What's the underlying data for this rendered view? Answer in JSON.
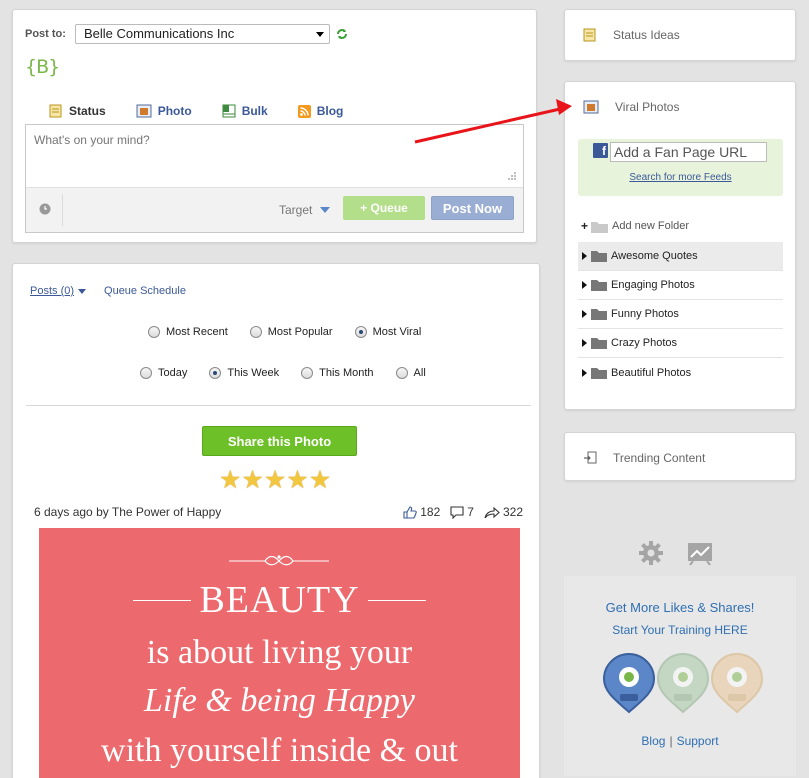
{
  "compose": {
    "post_to_label": "Post to:",
    "page_selected": "Belle Communications Inc",
    "brand_logo": "{B}",
    "tabs": [
      {
        "label": "Status",
        "icon": "note-icon",
        "active": true
      },
      {
        "label": "Photo",
        "icon": "photo-icon",
        "active": false
      },
      {
        "label": "Bulk",
        "icon": "spreadsheet-icon",
        "active": false
      },
      {
        "label": "Blog",
        "icon": "rss-icon",
        "active": false
      }
    ],
    "placeholder": "What's on your mind?",
    "target_label": "Target",
    "queue_label": "+ Queue",
    "post_now_label": "Post Now"
  },
  "feed": {
    "posts_label": "Posts (0)",
    "schedule_label": "Queue Schedule",
    "sort_options": [
      {
        "label": "Most Recent",
        "checked": false
      },
      {
        "label": "Most Popular",
        "checked": false
      },
      {
        "label": "Most Viral",
        "checked": true
      }
    ],
    "time_options": [
      {
        "label": "Today",
        "checked": false
      },
      {
        "label": "This Week",
        "checked": true
      },
      {
        "label": "This Month",
        "checked": false
      },
      {
        "label": "All",
        "checked": false
      }
    ],
    "share_label": "Share this Photo",
    "rating_stars": 5,
    "post_time": "6 days ago",
    "by_label": "by",
    "author": "The Power of Happy",
    "likes": "182",
    "comments": "7",
    "shares": "322",
    "photo_text": {
      "line1": "BEAUTY",
      "line2": "is about living your",
      "line3": "Life & being Happy",
      "line4": "with yourself inside & out"
    }
  },
  "sidebar": {
    "status_ideas": "Status Ideas",
    "viral_photos": "Viral Photos",
    "fan_page_placeholder": "Add a Fan Page URL",
    "search_feeds": "Search for more Feeds",
    "add_folder": "Add new Folder",
    "folders": [
      "Awesome Quotes",
      "Engaging Photos",
      "Funny Photos",
      "Crazy Photos",
      "Beautiful Photos"
    ],
    "trending": "Trending Content"
  },
  "promo": {
    "title": "Get More Likes & Shares!",
    "subtitle": "Start Your Training HERE",
    "badges": [
      "MASTER of Community",
      "MASTER of Engagement",
      "MASTER of Content"
    ],
    "blog_label": "Blog",
    "separator": "|",
    "support_label": "Support"
  },
  "colors": {
    "accent_blue": "#3b5998",
    "queue_green": "#b3de8a",
    "share_green": "#6dc027",
    "photo_bg": "#ec6a6e",
    "arrow_red": "#e8141a"
  }
}
